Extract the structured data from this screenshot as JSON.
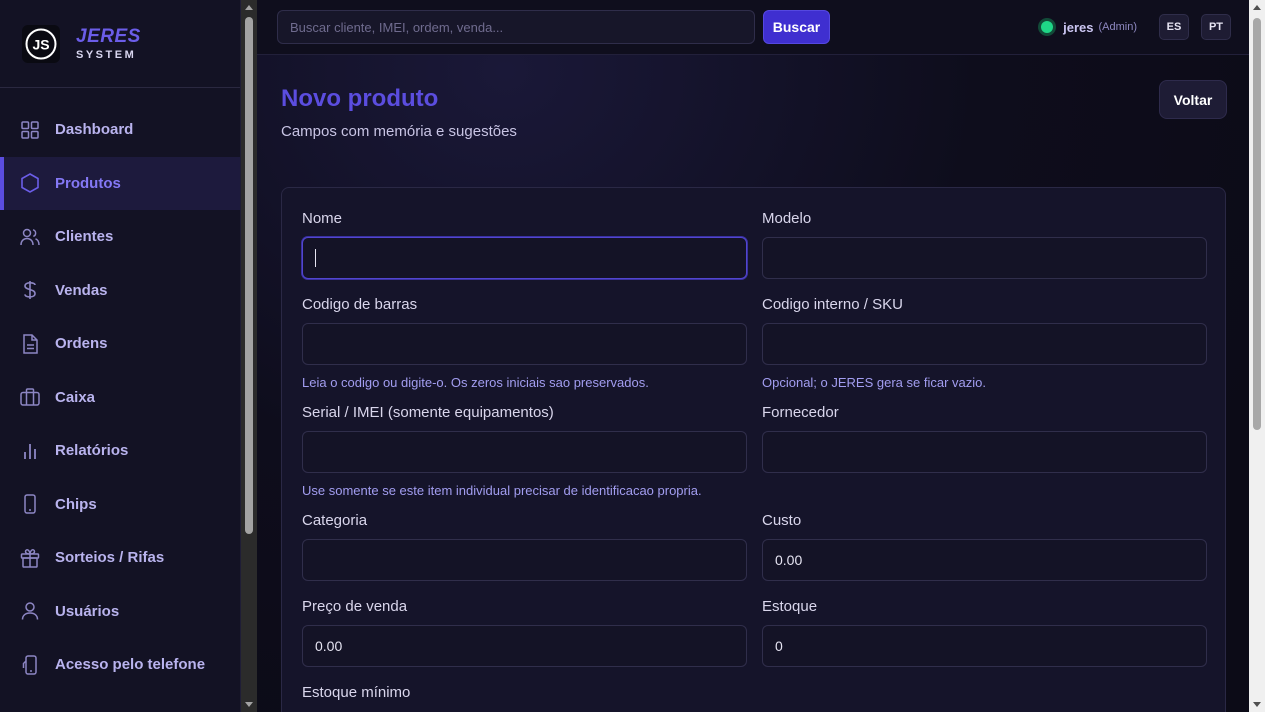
{
  "brand": {
    "logo_text": "JS",
    "name": "JERES",
    "subtitle": "SYSTEM"
  },
  "sidebar": {
    "items": [
      {
        "label": "Dashboard",
        "icon": "grid-icon",
        "active": false
      },
      {
        "label": "Produtos",
        "icon": "hexagon-icon",
        "active": true
      },
      {
        "label": "Clientes",
        "icon": "users-icon",
        "active": false
      },
      {
        "label": "Vendas",
        "icon": "dollar-icon",
        "active": false
      },
      {
        "label": "Ordens",
        "icon": "document-icon",
        "active": false
      },
      {
        "label": "Caixa",
        "icon": "briefcase-icon",
        "active": false
      },
      {
        "label": "Relatórios",
        "icon": "bar-chart-icon",
        "active": false
      },
      {
        "label": "Chips",
        "icon": "phone-icon",
        "active": false
      },
      {
        "label": "Sorteios / Rifas",
        "icon": "gift-icon",
        "active": false
      },
      {
        "label": "Usuários",
        "icon": "user-icon",
        "active": false
      },
      {
        "label": "Acesso pelo telefone",
        "icon": "mobile-access-icon",
        "active": false
      }
    ]
  },
  "topbar": {
    "search_placeholder": "Buscar cliente, IMEI, ordem, venda...",
    "search_button": "Buscar",
    "user_name": "jeres",
    "user_role": "(Admin)",
    "lang_es": "ES",
    "lang_pt": "PT"
  },
  "page": {
    "title": "Novo produto",
    "subtitle": "Campos com memória e sugestões",
    "back_button": "Voltar"
  },
  "form": {
    "nome": {
      "label": "Nome",
      "value": ""
    },
    "modelo": {
      "label": "Modelo",
      "value": ""
    },
    "codigo_barras": {
      "label": "Codigo de barras",
      "value": "",
      "hint": "Leia o codigo ou digite-o. Os zeros iniciais sao preservados."
    },
    "codigo_interno": {
      "label": "Codigo interno / SKU",
      "value": "",
      "hint": "Opcional; o JERES gera se ficar vazio."
    },
    "serial": {
      "label": "Serial / IMEI (somente equipamentos)",
      "value": "",
      "hint": "Use somente se este item individual precisar de identificacao propria."
    },
    "fornecedor": {
      "label": "Fornecedor",
      "value": ""
    },
    "categoria": {
      "label": "Categoria",
      "value": ""
    },
    "custo": {
      "label": "Custo",
      "value": "0.00"
    },
    "preco_venda": {
      "label": "Preço de venda",
      "value": "0.00"
    },
    "estoque": {
      "label": "Estoque",
      "value": "0"
    },
    "estoque_minimo": {
      "label": "Estoque mínimo"
    }
  },
  "colors": {
    "accent": "#5b4ddf",
    "button": "#3f2fd0",
    "status_online": "#1fd687"
  }
}
